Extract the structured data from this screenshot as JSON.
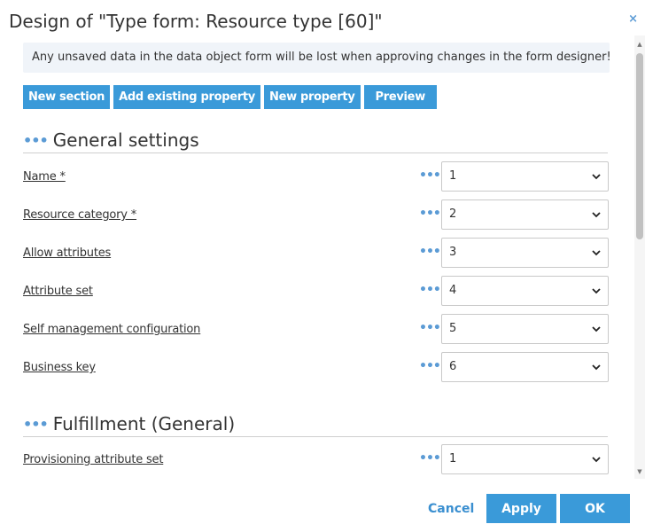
{
  "dialog": {
    "title": "Design of \"Type form: Resource type [60]\"",
    "close_glyph": "×"
  },
  "notice": {
    "text": "Any unsaved data in the data object form will be lost when approving changes in the form designer!"
  },
  "toolbar": {
    "new_section": "New section",
    "add_existing_property": "Add existing property",
    "new_property": "New property",
    "preview": "Preview"
  },
  "sections": [
    {
      "title": "General settings",
      "dots": "•••",
      "rows": [
        {
          "label": "Name *",
          "value": "1"
        },
        {
          "label": "Resource category *",
          "value": "2"
        },
        {
          "label": "Allow attributes",
          "value": "3"
        },
        {
          "label": "Attribute set",
          "value": "4"
        },
        {
          "label": "Self management configuration",
          "value": "5"
        },
        {
          "label": "Business key",
          "value": "6"
        }
      ]
    },
    {
      "title": "Fulfillment (General)",
      "dots": "•••",
      "rows": [
        {
          "label": "Provisioning attribute set",
          "value": "1"
        }
      ]
    }
  ],
  "row_dots": "•••",
  "footer": {
    "cancel": "Cancel",
    "apply": "Apply",
    "ok": "OK"
  },
  "colors": {
    "accent": "#3a9ad9",
    "notice_bg": "#f0f4f9"
  },
  "icons": {
    "close": "close-icon",
    "chevron": "chevron-down-icon",
    "dots": "more-options-icon"
  }
}
